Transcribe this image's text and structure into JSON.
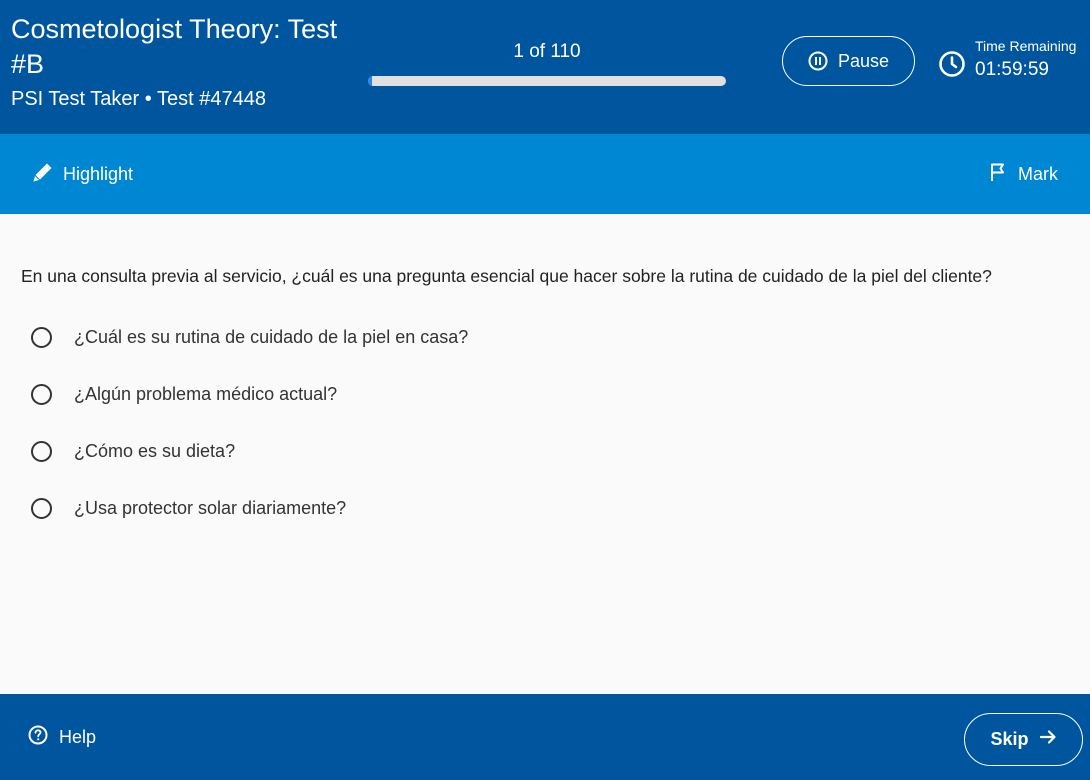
{
  "header": {
    "title": "Cosmetologist Theory: Test #B",
    "subtitle": "PSI Test Taker • Test #47448",
    "progress_text": "1 of 110",
    "progress_fraction": 0.00909,
    "pause_label": "Pause",
    "timer_label": "Time Remaining",
    "timer_value": "01:59:59"
  },
  "toolbar": {
    "highlight_label": "Highlight",
    "mark_label": "Mark"
  },
  "question": {
    "text": "En una consulta previa al servicio, ¿cuál es una pregunta esencial que hacer sobre la rutina de cuidado de la piel del cliente?",
    "options": [
      {
        "label": "¿Cuál es su rutina de cuidado de la piel en casa?"
      },
      {
        "label": "¿Algún problema médico actual?"
      },
      {
        "label": "¿Cómo es su dieta?"
      },
      {
        "label": "¿Usa protector solar diariamente?"
      }
    ]
  },
  "footer": {
    "help_label": "Help",
    "skip_label": "Skip"
  },
  "icons": {
    "pause": "pause-circle-icon",
    "clock": "clock-icon",
    "highlight": "pencil-icon",
    "mark": "flag-icon",
    "help": "question-circle-icon",
    "skip": "arrow-right-icon"
  },
  "colors": {
    "header_bg": "#00569e",
    "toolbar_bg": "#0087d3",
    "page_bg": "#fafafa",
    "progress_fill": "#2e86de"
  }
}
